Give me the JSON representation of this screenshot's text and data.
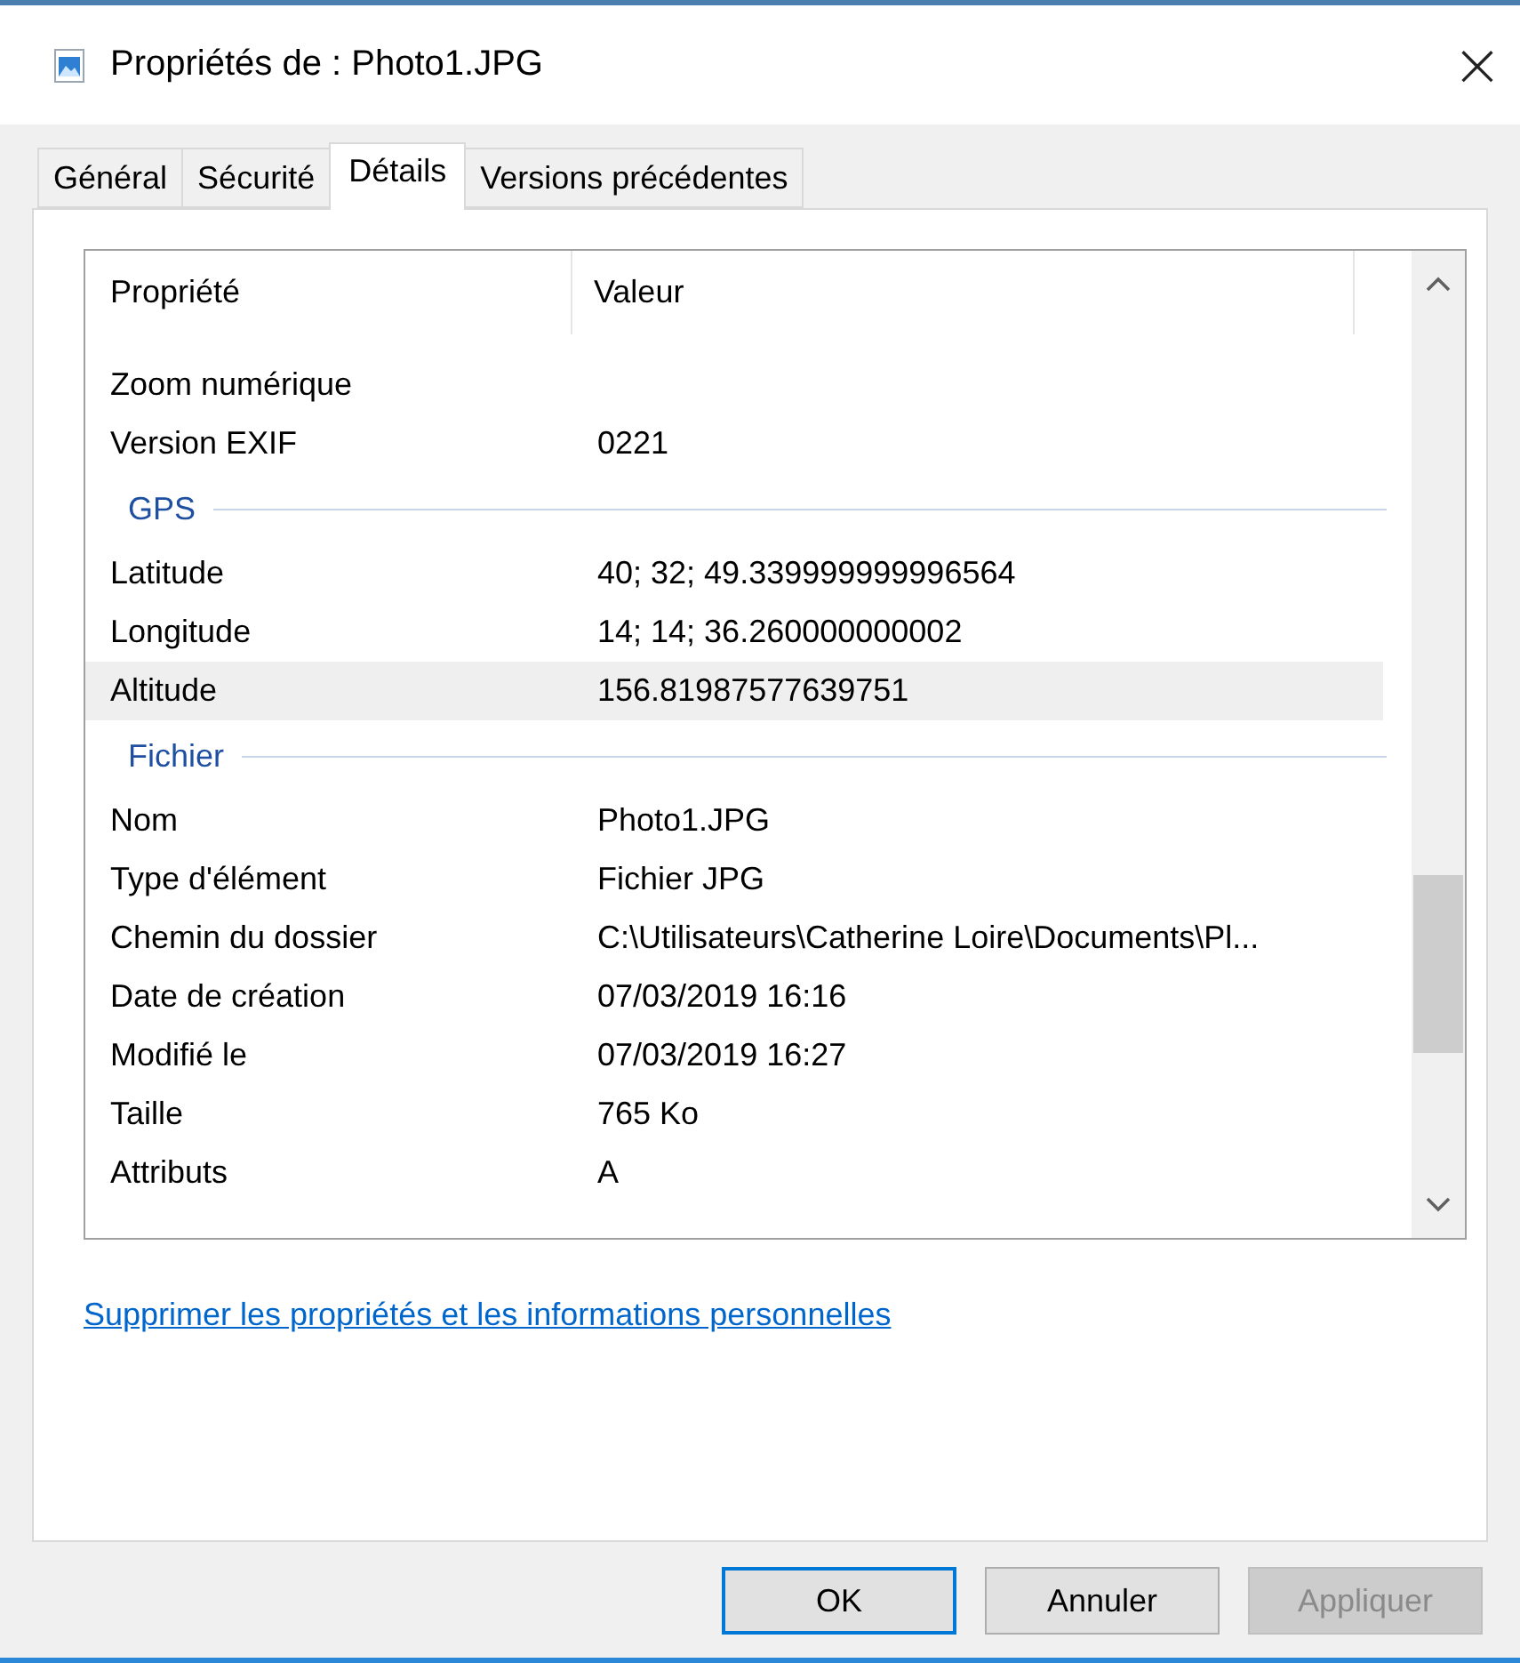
{
  "window": {
    "title": "Propriétés de : Photo1.JPG",
    "close": "×"
  },
  "tabs": [
    {
      "label": "Général",
      "selected": false
    },
    {
      "label": "Sécurité",
      "selected": false
    },
    {
      "label": "Détails",
      "selected": true
    },
    {
      "label": "Versions précédentes",
      "selected": false
    }
  ],
  "table": {
    "columns": [
      "Propriété",
      "Valeur"
    ],
    "rows": [
      {
        "kind": "row",
        "name": "Zoom numérique",
        "value": "",
        "selected": false
      },
      {
        "kind": "row",
        "name": "Version EXIF",
        "value": "0221",
        "selected": false
      },
      {
        "kind": "group",
        "name": "GPS"
      },
      {
        "kind": "row",
        "name": "Latitude",
        "value": "40; 32; 49.339999999996564",
        "selected": false
      },
      {
        "kind": "row",
        "name": "Longitude",
        "value": "14; 14; 36.260000000002",
        "selected": false
      },
      {
        "kind": "row",
        "name": "Altitude",
        "value": "156.81987577639751",
        "selected": true
      },
      {
        "kind": "group",
        "name": "Fichier"
      },
      {
        "kind": "row",
        "name": "Nom",
        "value": "Photo1.JPG",
        "selected": false
      },
      {
        "kind": "row",
        "name": "Type d'élément",
        "value": "Fichier JPG",
        "selected": false
      },
      {
        "kind": "row",
        "name": "Chemin du dossier",
        "value": "C:\\Utilisateurs\\Catherine Loire\\Documents\\Pl...",
        "selected": false
      },
      {
        "kind": "row",
        "name": "Date de création",
        "value": "07/03/2019 16:16",
        "selected": false
      },
      {
        "kind": "row",
        "name": "Modifié le",
        "value": "07/03/2019 16:27",
        "selected": false
      },
      {
        "kind": "row",
        "name": "Taille",
        "value": "765 Ko",
        "selected": false
      },
      {
        "kind": "row",
        "name": "Attributs",
        "value": "A",
        "selected": false
      }
    ]
  },
  "link": "Supprimer les propriétés et les informations personnelles",
  "buttons": [
    {
      "label": "OK",
      "default": true,
      "disabled": false
    },
    {
      "label": "Annuler",
      "default": false,
      "disabled": false
    },
    {
      "label": "Appliquer",
      "default": false,
      "disabled": true
    }
  ]
}
